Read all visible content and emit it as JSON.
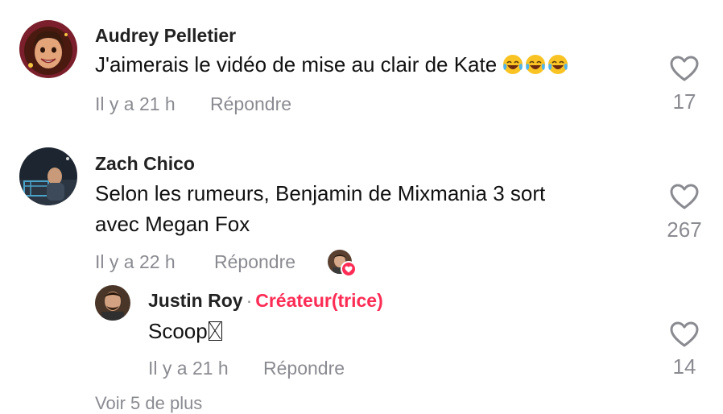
{
  "comments": [
    {
      "author": "Audrey Pelletier",
      "text": "J'aimerais le vidéo de mise au clair de Kate",
      "emojis": [
        "face-with-tears-of-joy-icon",
        "face-with-tears-of-joy-icon",
        "face-with-tears-of-joy-icon"
      ],
      "time": "Il y a 21 h",
      "reply_label": "Répondre",
      "likes": "17"
    },
    {
      "author": "Zach Chico",
      "text_line1": "Selon les rumeurs, Benjamin de Mixmania 3 sort",
      "text_line2": "avec Megan Fox",
      "time": "Il y a 22 h",
      "reply_label": "Répondre",
      "likes": "267",
      "creator_liked": true
    }
  ],
  "reply": {
    "author": "Justin Roy",
    "separator": "·",
    "badge": "Créateur(trice)",
    "text": "Scoop",
    "time": "Il y a 21 h",
    "reply_label": "Répondre",
    "likes": "14"
  },
  "view_more": "Voir 5 de plus",
  "colors": {
    "accent": "#fe2c55",
    "muted": "#8a8b91",
    "text": "#161823"
  }
}
